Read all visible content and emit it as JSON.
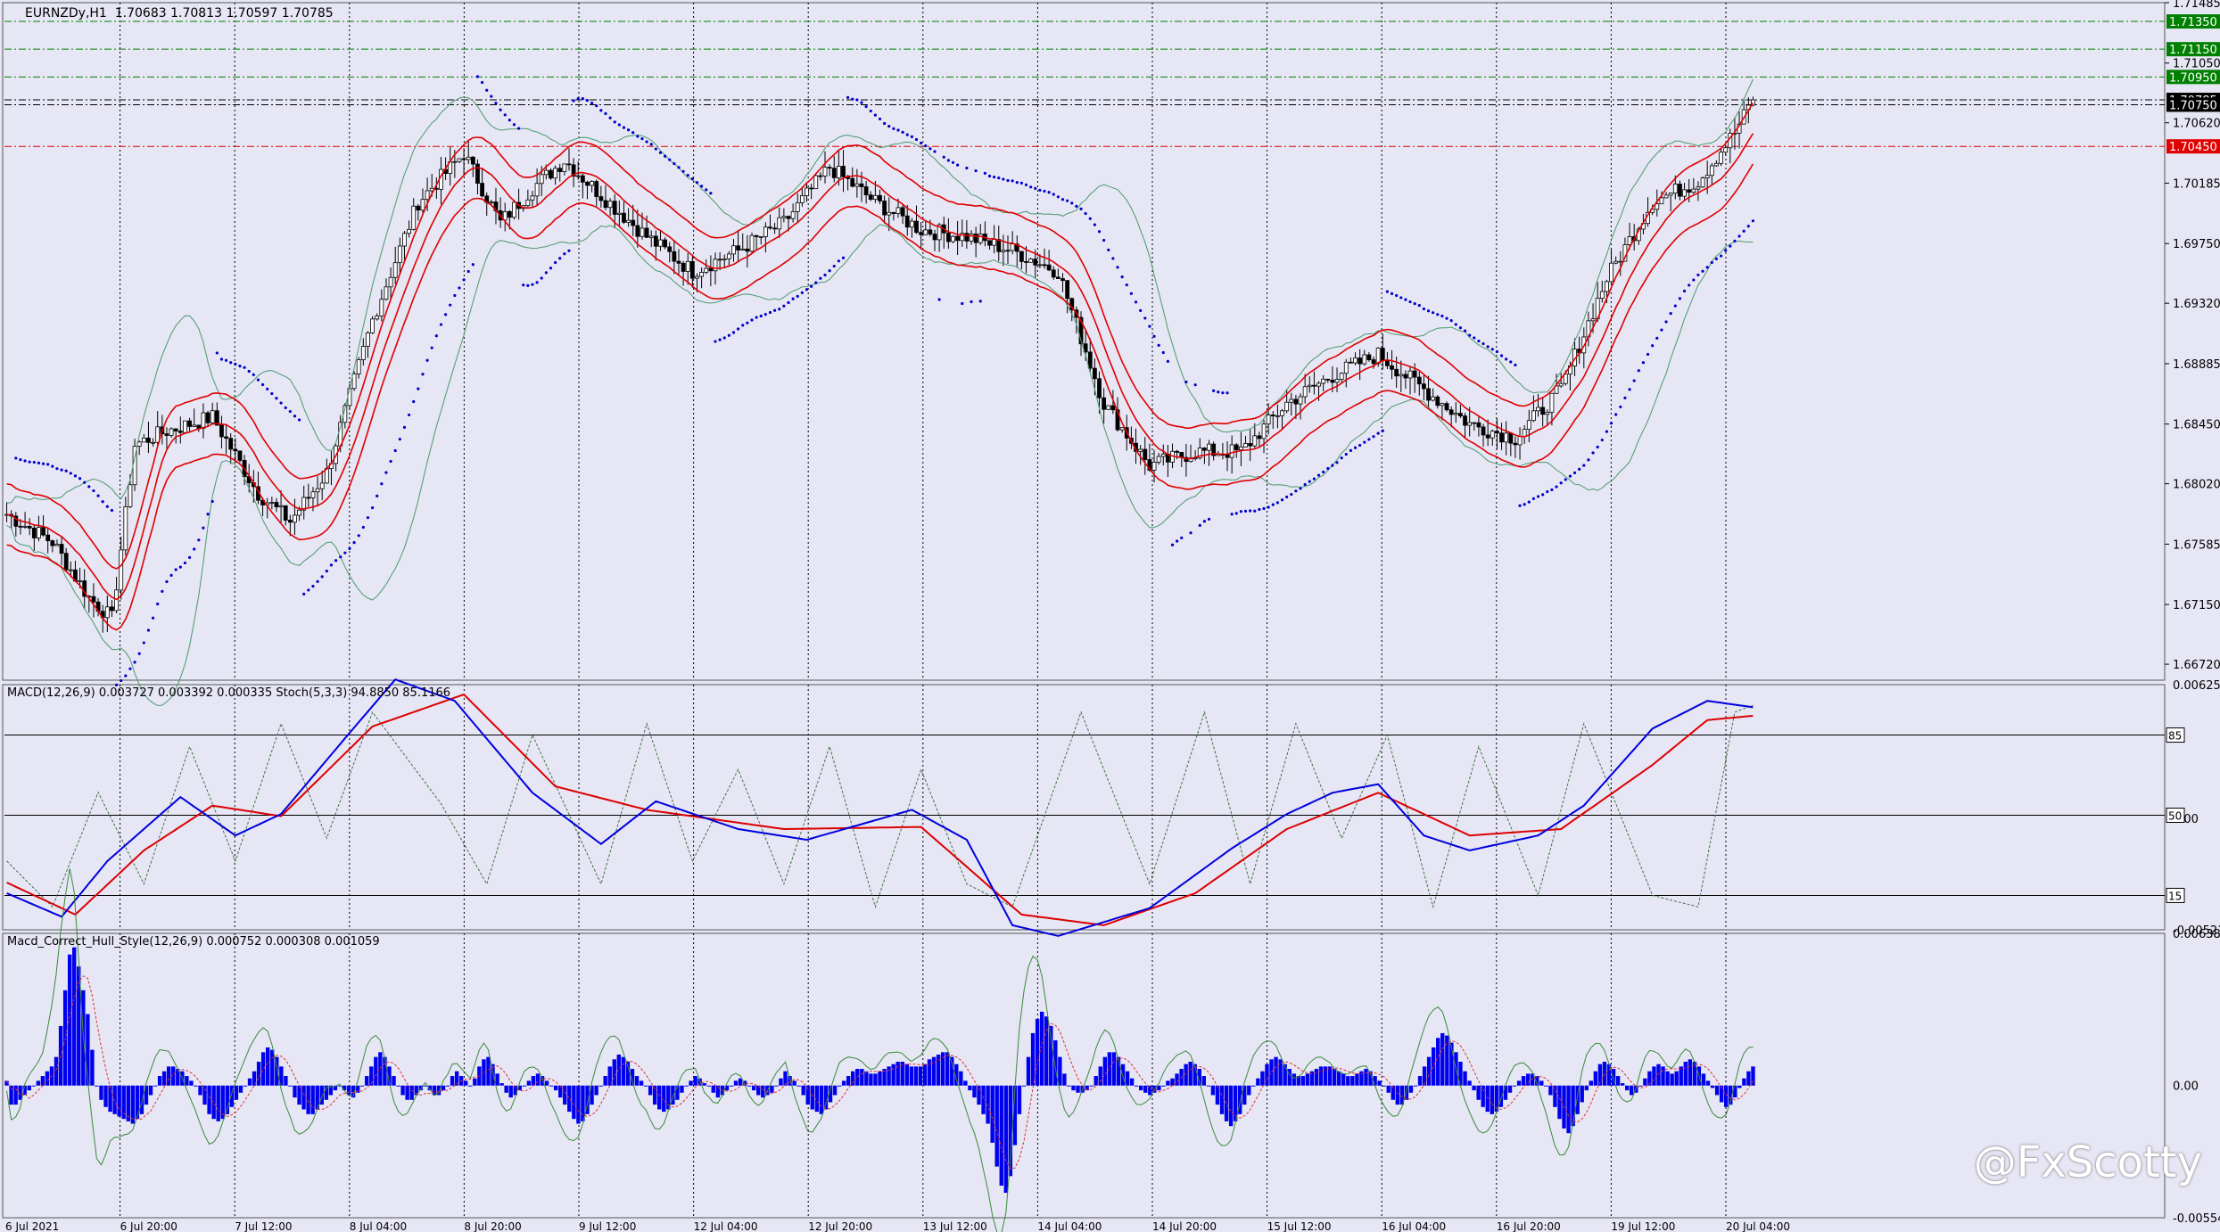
{
  "window": {
    "symbol_label": "EURNZDy,H1",
    "ohlc": "1.70683 1.70813 1.70597 1.70785"
  },
  "panels": {
    "main": {
      "price_min": 1.66605,
      "price_max": 1.71485
    },
    "macd": {
      "label": "MACD(12,26,9) 0.003727 0.003392 0.000335  Stoch(5,3,3) 94.8850 85.1166",
      "macd_min": -0.005212,
      "macd_max": 0.006258,
      "axis_labels": [
        "0.006258",
        "0.00",
        "-0.005212"
      ],
      "stoch_levels": [
        "85",
        "50",
        "15"
      ]
    },
    "hull": {
      "label": "Macd_Correct_Hull_Style(12,26,9) 0.000752 0.000308 0.001059",
      "min": -0.005547,
      "max": 0.006388,
      "axis_labels": [
        "0.006388",
        "0.00",
        "-0.005547"
      ]
    }
  },
  "colors": {
    "background": "#e6e6f5",
    "bull_candle": "#ffffff",
    "bear_candle": "#000000",
    "bollinger": "#4a9a6a",
    "envelope": "#e00000",
    "sar": "#0000cc",
    "macd_line": "#0000dd",
    "signal_line": "#dd0000",
    "stoch": "#407040",
    "histogram": "#0000ee",
    "green_level": "#008000",
    "red_level": "#e00000"
  },
  "chart_data": {
    "type": "candlestick",
    "title": "EURNZDy,H1",
    "price_axis_labels": [
      "1.71485",
      "1.71050",
      "1.70620",
      "1.70185",
      "1.69750",
      "1.69320",
      "1.68885",
      "1.68450",
      "1.68020",
      "1.67585",
      "1.67150",
      "1.66720"
    ],
    "level_lines": [
      {
        "price": 1.7135,
        "label": "1.71350",
        "color": "#008000",
        "style": "dashdot"
      },
      {
        "price": 1.7115,
        "label": "1.71150",
        "color": "#008000",
        "style": "dashdot"
      },
      {
        "price": 1.7095,
        "label": "1.70950",
        "color": "#008000",
        "style": "dashdot"
      },
      {
        "price": 1.70785,
        "label": "1.70785",
        "color": "#000000",
        "style": "dashdot"
      },
      {
        "price": 1.7075,
        "label": "1.70750",
        "color": "#000000",
        "style": "dashdot"
      },
      {
        "price": 1.7045,
        "label": "1.70450",
        "color": "#e00000",
        "style": "dashdot"
      }
    ],
    "time_axis_labels": [
      "6 Jul 2021",
      "6 Jul 20:00",
      "7 Jul 12:00",
      "8 Jul 04:00",
      "8 Jul 20:00",
      "9 Jul 12:00",
      "12 Jul 04:00",
      "12 Jul 20:00",
      "13 Jul 12:00",
      "14 Jul 04:00",
      "14 Jul 20:00",
      "15 Jul 12:00",
      "16 Jul 04:00",
      "16 Jul 20:00",
      "19 Jul 12:00",
      "20 Jul 04:00"
    ],
    "close_path": [
      [
        0,
        1.678
      ],
      [
        10,
        1.676
      ],
      [
        18,
        1.672
      ],
      [
        23,
        1.6705
      ],
      [
        28,
        1.683
      ],
      [
        35,
        1.684
      ],
      [
        45,
        1.685
      ],
      [
        55,
        1.6795
      ],
      [
        62,
        1.6775
      ],
      [
        70,
        1.681
      ],
      [
        80,
        1.692
      ],
      [
        90,
        1.7005
      ],
      [
        100,
        1.704
      ],
      [
        108,
        1.699
      ],
      [
        115,
        1.7015
      ],
      [
        122,
        1.7035
      ],
      [
        130,
        1.701
      ],
      [
        140,
        1.698
      ],
      [
        150,
        1.6955
      ],
      [
        160,
        1.697
      ],
      [
        170,
        1.699
      ],
      [
        180,
        1.703
      ],
      [
        190,
        1.7005
      ],
      [
        200,
        1.6985
      ],
      [
        210,
        1.698
      ],
      [
        220,
        1.697
      ],
      [
        230,
        1.6955
      ],
      [
        240,
        1.686
      ],
      [
        250,
        1.6815
      ],
      [
        260,
        1.6825
      ],
      [
        270,
        1.6825
      ],
      [
        280,
        1.686
      ],
      [
        290,
        1.688
      ],
      [
        300,
        1.6895
      ],
      [
        310,
        1.687
      ],
      [
        320,
        1.6845
      ],
      [
        330,
        1.6835
      ],
      [
        340,
        1.687
      ],
      [
        350,
        1.695
      ],
      [
        360,
        1.7005
      ],
      [
        370,
        1.702
      ],
      [
        378,
        1.7055
      ],
      [
        382,
        1.70785
      ]
    ],
    "macd": {
      "macd_line": [
        [
          0,
          -0.0035
        ],
        [
          12,
          -0.0046
        ],
        [
          22,
          -0.002
        ],
        [
          38,
          0.001
        ],
        [
          50,
          -0.0008
        ],
        [
          60,
          0.0002
        ],
        [
          75,
          0.004
        ],
        [
          85,
          0.0065
        ],
        [
          98,
          0.0055
        ],
        [
          115,
          0.0012
        ],
        [
          130,
          -0.0012
        ],
        [
          142,
          0.0008
        ],
        [
          160,
          -0.0005
        ],
        [
          175,
          -0.001
        ],
        [
          198,
          0.0004
        ],
        [
          210,
          -0.001
        ],
        [
          220,
          -0.005
        ],
        [
          230,
          -0.0055
        ],
        [
          250,
          -0.0042
        ],
        [
          268,
          -0.0014
        ],
        [
          280,
          0.0002
        ],
        [
          290,
          0.0012
        ],
        [
          300,
          0.0016
        ],
        [
          310,
          -0.0008
        ],
        [
          320,
          -0.0015
        ],
        [
          335,
          -0.0008
        ],
        [
          345,
          0.0006
        ],
        [
          360,
          0.0042
        ],
        [
          372,
          0.0055
        ],
        [
          382,
          0.0052
        ]
      ],
      "signal_line": [
        [
          0,
          -0.003
        ],
        [
          15,
          -0.0045
        ],
        [
          30,
          -0.0015
        ],
        [
          45,
          0.0006
        ],
        [
          60,
          0.0001
        ],
        [
          80,
          0.0043
        ],
        [
          100,
          0.0058
        ],
        [
          120,
          0.0015
        ],
        [
          140,
          0.0004
        ],
        [
          170,
          -0.0005
        ],
        [
          200,
          -0.0004
        ],
        [
          222,
          -0.0045
        ],
        [
          240,
          -0.005
        ],
        [
          260,
          -0.0035
        ],
        [
          280,
          -0.0005
        ],
        [
          300,
          0.0012
        ],
        [
          320,
          -0.0008
        ],
        [
          340,
          -0.0005
        ],
        [
          360,
          0.0025
        ],
        [
          372,
          0.0046
        ],
        [
          382,
          0.0048
        ]
      ],
      "stoch": [
        [
          0,
          30
        ],
        [
          10,
          10
        ],
        [
          20,
          60
        ],
        [
          30,
          20
        ],
        [
          40,
          80
        ],
        [
          50,
          30
        ],
        [
          60,
          90
        ],
        [
          70,
          40
        ],
        [
          80,
          95
        ],
        [
          95,
          55
        ],
        [
          105,
          20
        ],
        [
          115,
          85
        ],
        [
          130,
          20
        ],
        [
          140,
          90
        ],
        [
          150,
          30
        ],
        [
          160,
          70
        ],
        [
          170,
          20
        ],
        [
          180,
          80
        ],
        [
          190,
          10
        ],
        [
          200,
          70
        ],
        [
          210,
          20
        ],
        [
          220,
          10
        ],
        [
          235,
          95
        ],
        [
          250,
          20
        ],
        [
          262,
          95
        ],
        [
          272,
          20
        ],
        [
          282,
          90
        ],
        [
          292,
          40
        ],
        [
          302,
          85
        ],
        [
          312,
          10
        ],
        [
          322,
          80
        ],
        [
          335,
          15
        ],
        [
          345,
          90
        ],
        [
          360,
          15
        ],
        [
          370,
          10
        ],
        [
          378,
          95
        ],
        [
          382,
          98
        ]
      ]
    },
    "hull_histogram": [
      0.0002,
      -0.0008,
      -0.0008,
      -0.0006,
      -0.0004,
      -0.0002,
      0,
      0.0002,
      0.0004,
      0.0006,
      0.0008,
      0.0012,
      0.0025,
      0.004,
      0.0055,
      0.0058,
      0.005,
      0.004,
      0.003,
      0.0015,
      0,
      -0.0006,
      -0.0009,
      -0.0011,
      -0.0012,
      -0.0013,
      -0.0014,
      -0.0015,
      -0.0016,
      -0.0014,
      -0.0012,
      -0.0008,
      -0.0004,
      0,
      0.0004,
      0.0006,
      0.0008,
      0.0008,
      0.0007,
      0.0006,
      0.0004,
      0.0002,
      0,
      -0.0004,
      -0.0008,
      -0.0012,
      -0.0014,
      -0.0015,
      -0.0014,
      -0.0012,
      -0.0009,
      -0.0006,
      -0.0003,
      0,
      0.0003,
      0.0006,
      0.001,
      0.0014,
      0.0016,
      0.0015,
      0.0012,
      0.0008,
      0.0004,
      0,
      -0.0005,
      -0.0008,
      -0.001,
      -0.0012,
      -0.0012,
      -0.001,
      -0.0008,
      -0.0006,
      -0.0004,
      -0.0002,
      0,
      -0.0002,
      -0.0004,
      -0.0005,
      -0.0003,
      0,
      0.0004,
      0.0008,
      0.0012,
      0.0014,
      0.0012,
      0.0008,
      0.0004,
      0,
      -0.0004,
      -0.0006,
      -0.0006,
      -0.0004,
      -0.0002,
      0,
      -0.0002,
      -0.0004,
      -0.0004,
      -0.0002,
      0,
      0.0004,
      0.0006,
      0.0004,
      0.0002,
      0,
      0.0003,
      0.0008,
      0.0011,
      0.0012,
      0.0009,
      0.0005,
      0.0001,
      -0.0003,
      -0.0005,
      -0.0004,
      -0.0002,
      0,
      0.0002,
      0.0004,
      0.0005,
      0.0004,
      0.0002,
      0,
      -0.0002,
      -0.0005,
      -0.0008,
      -0.0011,
      -0.0014,
      -0.0016,
      -0.0015,
      -0.0012,
      -0.0008,
      -0.0004,
      0,
      0.0004,
      0.0008,
      0.0011,
      0.0013,
      0.0012,
      0.001,
      0.0007,
      0.0004,
      0.0002,
      0,
      -0.0004,
      -0.0008,
      -0.001,
      -0.0011,
      -0.001,
      -0.0008,
      -0.0006,
      -0.0003,
      0,
      0.0002,
      0.0004,
      0.0003,
      0.0001,
      0,
      -0.0003,
      -0.0005,
      -0.0004,
      -0.0002,
      0,
      0.0002,
      0.0003,
      0.0002,
      0,
      -0.0002,
      -0.0004,
      -0.0005,
      -0.0004,
      -0.0003,
      0,
      0.0003,
      0.0006,
      0.0004,
      0.0002,
      0,
      -0.0004,
      -0.0008,
      -0.001,
      -0.0011,
      -0.0012,
      -0.001,
      -0.0007,
      -0.0004,
      0,
      0.0002,
      0.0004,
      0.0006,
      0.0007,
      0.0007,
      0.0006,
      0.0005,
      0.0005,
      0.0006,
      0.0007,
      0.0008,
      0.0009,
      0.001,
      0.001,
      0.0009,
      0.0008,
      0.0008,
      0.0008,
      0.0009,
      0.0011,
      0.0012,
      0.0013,
      0.0014,
      0.0014,
      0.0012,
      0.0009,
      0.0006,
      0.0002,
      -0.0002,
      -0.0005,
      -0.0008,
      -0.0012,
      -0.0016,
      -0.0024,
      -0.0034,
      -0.0042,
      -0.0045,
      -0.0038,
      -0.0025,
      -0.0012,
      0,
      0.0012,
      0.0022,
      0.0028,
      0.0031,
      0.0029,
      0.0025,
      0.0019,
      0.0012,
      0.0005,
      0,
      -0.0002,
      -0.0003,
      -0.0003,
      -0.0002,
      0,
      0.0004,
      0.0008,
      0.0012,
      0.0014,
      0.0014,
      0.0012,
      0.0009,
      0.0006,
      0.0003,
      0,
      -0.0002,
      -0.0003,
      -0.0004,
      -0.0003,
      -0.0002,
      0,
      0.0002,
      0.0003,
      0.0005,
      0.0007,
      0.0009,
      0.001,
      0.0009,
      0.0007,
      0.0004,
      0,
      -0.0004,
      -0.0008,
      -0.0012,
      -0.0015,
      -0.0017,
      -0.0015,
      -0.0012,
      -0.0008,
      -0.0004,
      0,
      0.0003,
      0.0006,
      0.0009,
      0.0011,
      0.0012,
      0.0011,
      0.0009,
      0.0007,
      0.0005,
      0.0004,
      0.0004,
      0.0005,
      0.0006,
      0.0007,
      0.0008,
      0.0008,
      0.0008,
      0.0007,
      0.0006,
      0.0005,
      0.0004,
      0.0004,
      0.0005,
      0.0006,
      0.0007,
      0.0006,
      0.0004,
      0.0002,
      0,
      -0.0003,
      -0.0006,
      -0.0008,
      -0.0008,
      -0.0006,
      -0.0003,
      0,
      0.0004,
      0.0008,
      0.0012,
      0.0016,
      0.002,
      0.0022,
      0.0021,
      0.0018,
      0.0014,
      0.001,
      0.0006,
      0.0002,
      -0.0002,
      -0.0006,
      -0.0009,
      -0.0011,
      -0.0012,
      -0.0011,
      -0.0009,
      -0.0006,
      -0.0003,
      0,
      0.0002,
      0.0004,
      0.0005,
      0.0005,
      0.0004,
      0.0002,
      0,
      -0.0004,
      -0.0009,
      -0.0014,
      -0.0018,
      -0.002,
      -0.0017,
      -0.0012,
      -0.0007,
      -0.0002,
      0.0002,
      0.0006,
      0.0009,
      0.001,
      0.0009,
      0.0007,
      0.0004,
      0.0001,
      -0.0002,
      -0.0004,
      -0.0003,
      0,
      0.0003,
      0.0006,
      0.0008,
      0.0009,
      0.0008,
      0.0006,
      0.0005,
      0.0006,
      0.0008,
      0.001,
      0.0011,
      0.001,
      0.0008,
      0.0005,
      0.0002,
      -0.0001,
      -0.0004,
      -0.0007,
      -0.0009,
      -0.0008,
      -0.0005,
      -0.0001,
      0.0003,
      0.0006,
      0.0008
    ]
  },
  "watermark": "@FxScotty"
}
